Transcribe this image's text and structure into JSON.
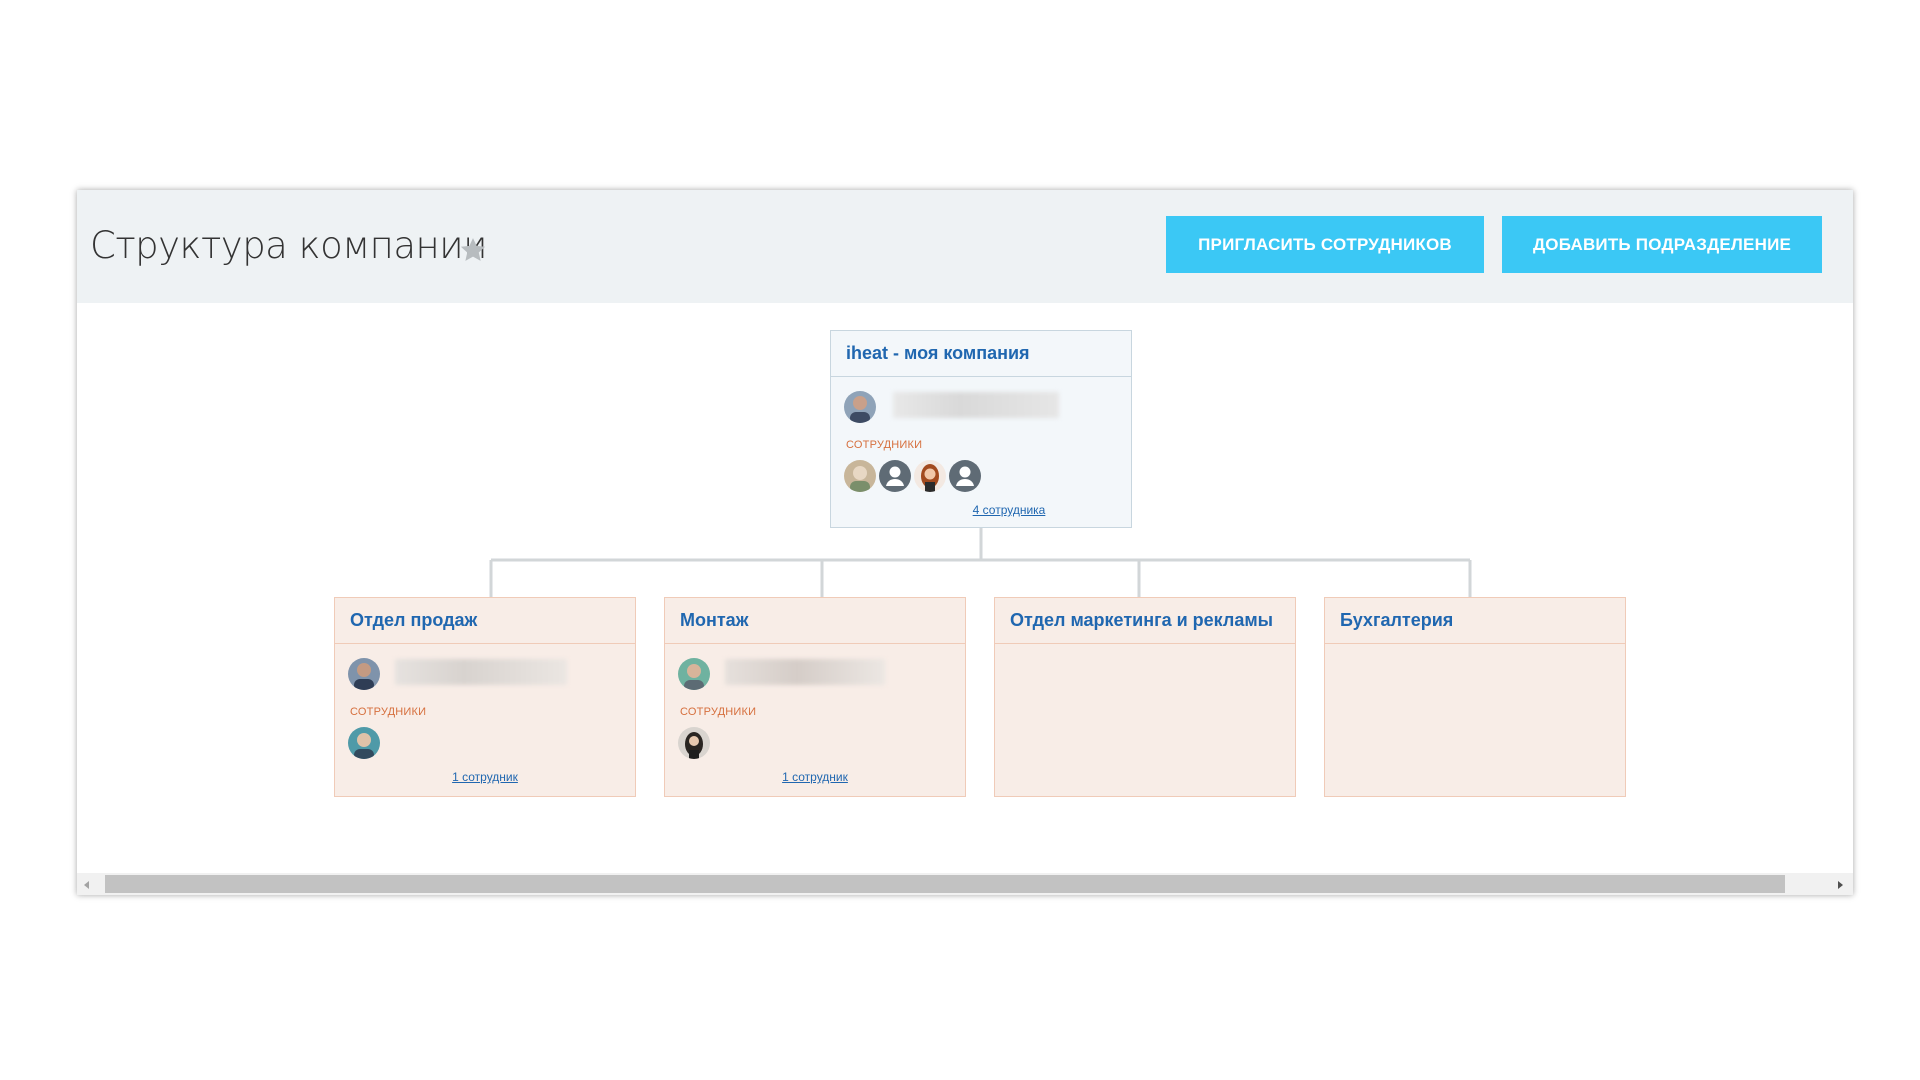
{
  "header": {
    "title": "Структура компании",
    "star_icon": "star-icon",
    "invite_button": "ПРИГЛАСИТЬ СОТРУДНИКОВ",
    "add_button": "ДОБАВИТЬ ПОДРАЗДЕЛЕНИЕ"
  },
  "root": {
    "title": "iheat - моя компания",
    "employees_label": "СОТРУДНИКИ",
    "employee_count": "4 сотрудника"
  },
  "departments": [
    {
      "title": "Отдел продаж",
      "employees_label": "СОТРУДНИКИ",
      "employee_count": "1 сотрудник"
    },
    {
      "title": "Монтаж",
      "employees_label": "СОТРУДНИКИ",
      "employee_count": "1 сотрудник"
    },
    {
      "title": "Отдел маркетинга и рекламы"
    },
    {
      "title": "Бухгалтерия"
    }
  ],
  "colors": {
    "accent": "#3bc8f5",
    "link": "#2067b0",
    "label": "#d66f3d",
    "dept_bg": "#f8ede7",
    "root_bg": "#f3f7fa"
  },
  "scrollbar": {
    "thumb_fraction": 0.95
  }
}
